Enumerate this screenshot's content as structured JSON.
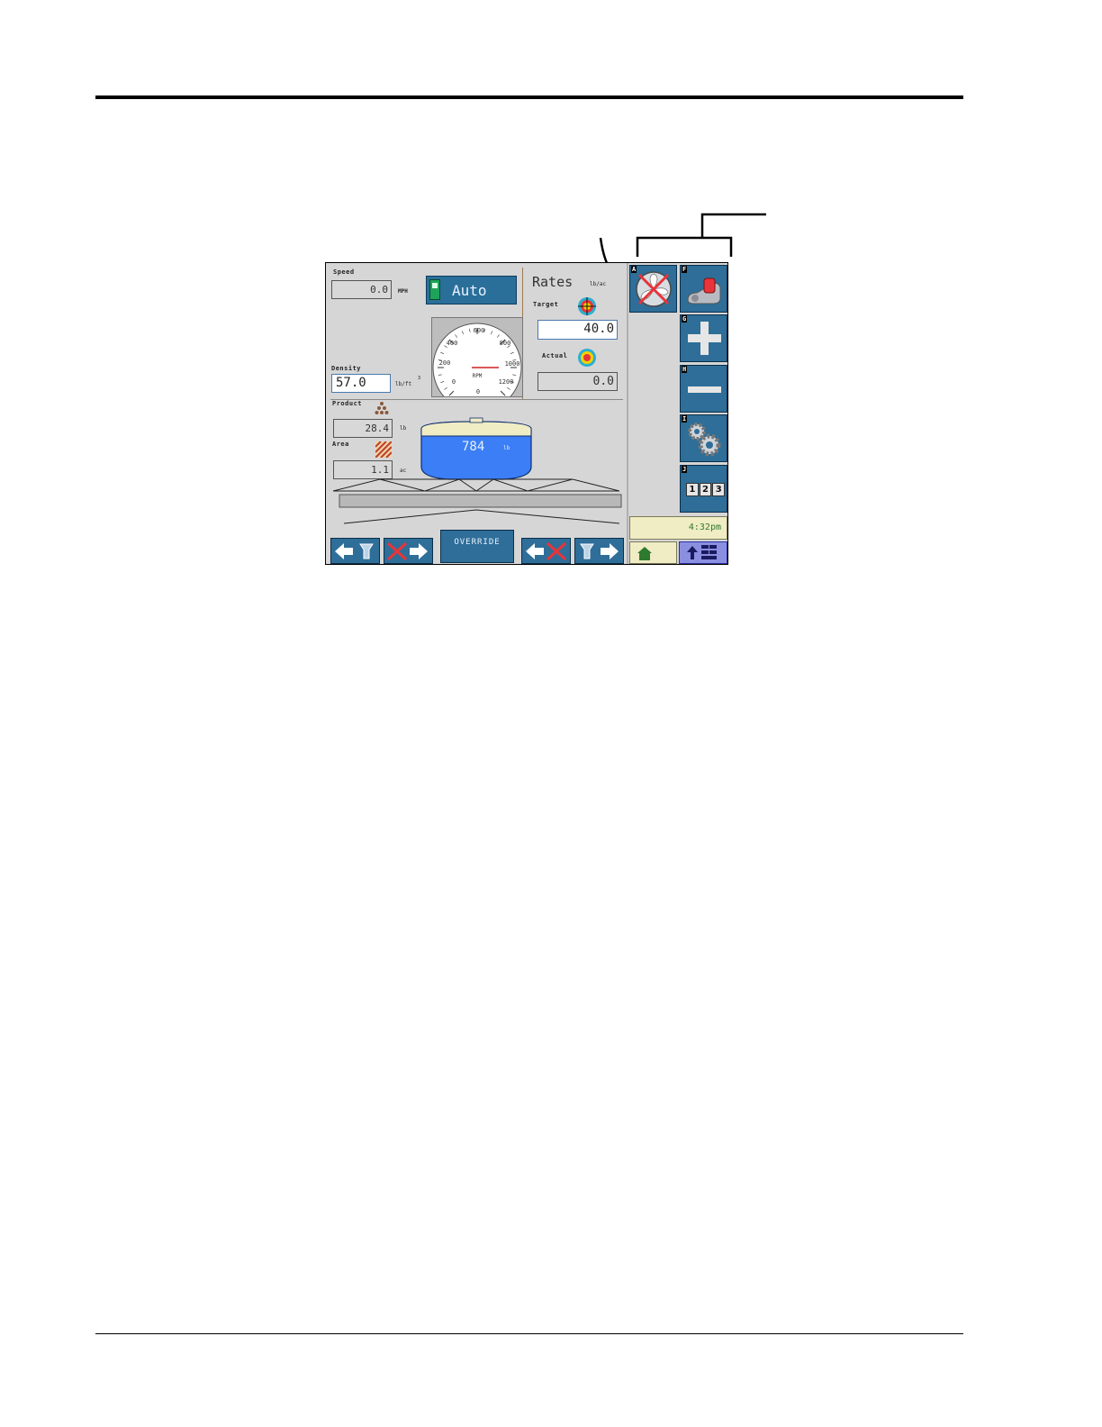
{
  "screen": {
    "speed": {
      "label": "Speed",
      "value": "0.0",
      "unit": "MPH"
    },
    "mode_button": {
      "label": "Auto"
    },
    "rates": {
      "title": "Rates",
      "unit": "lb/ac",
      "target": {
        "label": "Target",
        "value": "40.0"
      },
      "actual": {
        "label": "Actual",
        "value": "0.0"
      }
    },
    "gauge": {
      "unit": "RPM",
      "ticks": [
        "0",
        "200",
        "400",
        "600",
        "800",
        "1000",
        "1200",
        "0"
      ],
      "needle_value": 1000
    },
    "density": {
      "label": "Density",
      "value": "57.0",
      "unit": "lb/ft",
      "unit_sup": "3"
    },
    "product": {
      "label": "Product",
      "value": "28.4",
      "unit": "lb"
    },
    "area": {
      "label": "Area",
      "value": "1.1",
      "unit": "ac"
    },
    "tank": {
      "value": "784",
      "unit": "lb"
    },
    "override_button": {
      "label": "OVERRIDE"
    },
    "side_buttons": [
      {
        "key": "A",
        "icon": "fan-off-icon"
      },
      {
        "key": "F",
        "icon": "spinner-icon"
      },
      {
        "key": "G",
        "icon": "plus-icon"
      },
      {
        "key": "H",
        "icon": "minus-icon"
      },
      {
        "key": "I",
        "icon": "gears-icon"
      },
      {
        "key": "J",
        "icon": "numeric-keypad-icon",
        "digits": [
          "1",
          "2",
          "3"
        ]
      }
    ],
    "time": "4:32pm",
    "bottom_tabs": [
      {
        "icon": "home-icon"
      },
      {
        "icon": "menu-up-icon"
      }
    ]
  },
  "colors": {
    "button_blue": "#2e6e98",
    "tank_blue": "#3b7ef5",
    "screen_gray": "#d6d6d6",
    "time_bg": "#f0ecc4",
    "alert_red": "#e8343a"
  }
}
